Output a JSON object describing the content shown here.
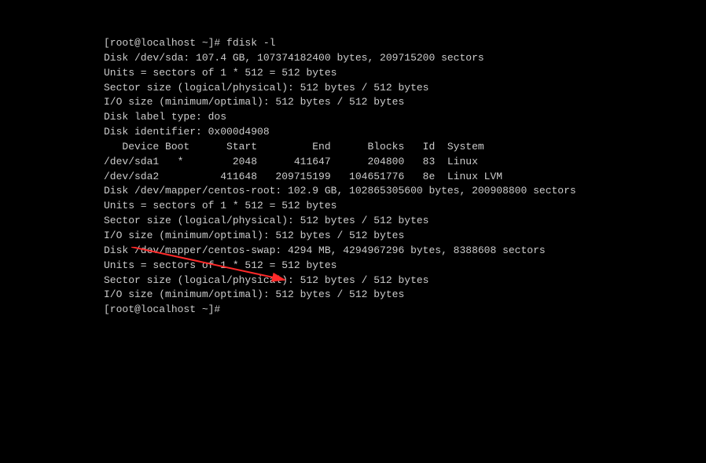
{
  "lines": {
    "l0": "[root@localhost ~]# fdisk -l",
    "l1": "",
    "l2": "Disk /dev/sda: 107.4 GB, 107374182400 bytes, 209715200 sectors",
    "l3": "Units = sectors of 1 * 512 = 512 bytes",
    "l4": "Sector size (logical/physical): 512 bytes / 512 bytes",
    "l5": "I/O size (minimum/optimal): 512 bytes / 512 bytes",
    "l6": "Disk label type: dos",
    "l7": "Disk identifier: 0x000d4908",
    "l8": "",
    "l9": "   Device Boot      Start         End      Blocks   Id  System",
    "l10": "/dev/sda1   *        2048      411647      204800   83  Linux",
    "l11": "/dev/sda2          411648   209715199   104651776   8e  Linux LVM",
    "l12": "",
    "l13": "Disk /dev/mapper/centos-root: 102.9 GB, 102865305600 bytes, 200908800 sectors",
    "l14": "Units = sectors of 1 * 512 = 512 bytes",
    "l15": "Sector size (logical/physical): 512 bytes / 512 bytes",
    "l16": "I/O size (minimum/optimal): 512 bytes / 512 bytes",
    "l17": "",
    "l18": "",
    "l19": "Disk /dev/mapper/centos-swap: 4294 MB, 4294967296 bytes, 8388608 sectors",
    "l20": "Units = sectors of 1 * 512 = 512 bytes",
    "l21": "Sector size (logical/physical): 512 bytes / 512 bytes",
    "l22": "I/O size (minimum/optimal): 512 bytes / 512 bytes",
    "l23": "",
    "l24": "[root@localhost ~]# "
  }
}
